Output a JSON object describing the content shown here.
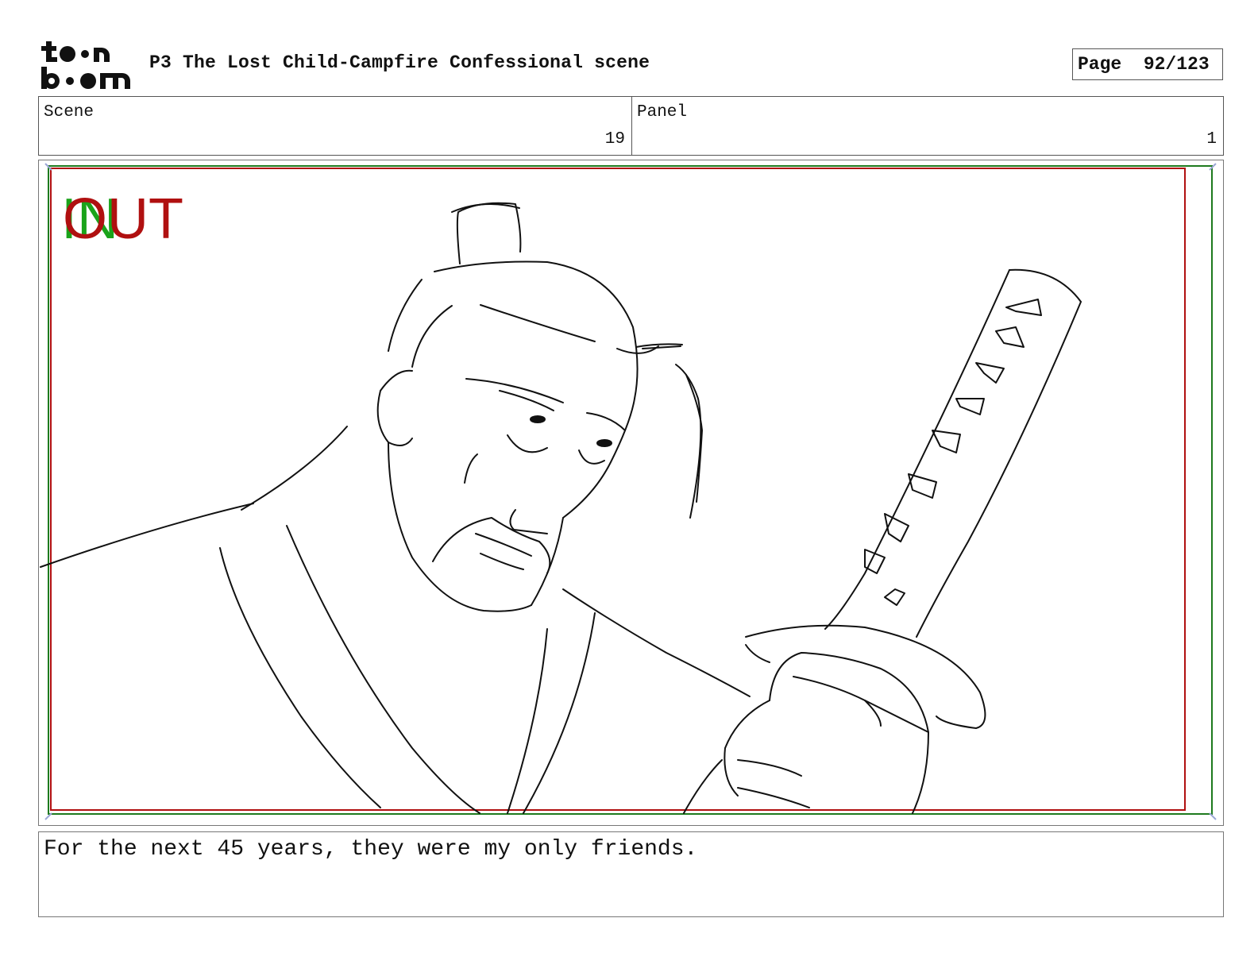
{
  "header": {
    "logo_icon": "toonboom-logo-icon",
    "title": "P3 The Lost Child-Campfire Confessional scene",
    "page_label": "Page",
    "page_value": "92/123"
  },
  "info": {
    "scene_label": "Scene",
    "scene_value": "19",
    "panel_label": "Panel",
    "panel_value": "1"
  },
  "panel": {
    "in_marker": "IN",
    "out_marker": "OUT",
    "in_color": "#1aa31a",
    "out_color": "#b01010",
    "illustration": "samurai-sketch"
  },
  "caption": {
    "text": "For the next 45 years, they were my only friends."
  }
}
